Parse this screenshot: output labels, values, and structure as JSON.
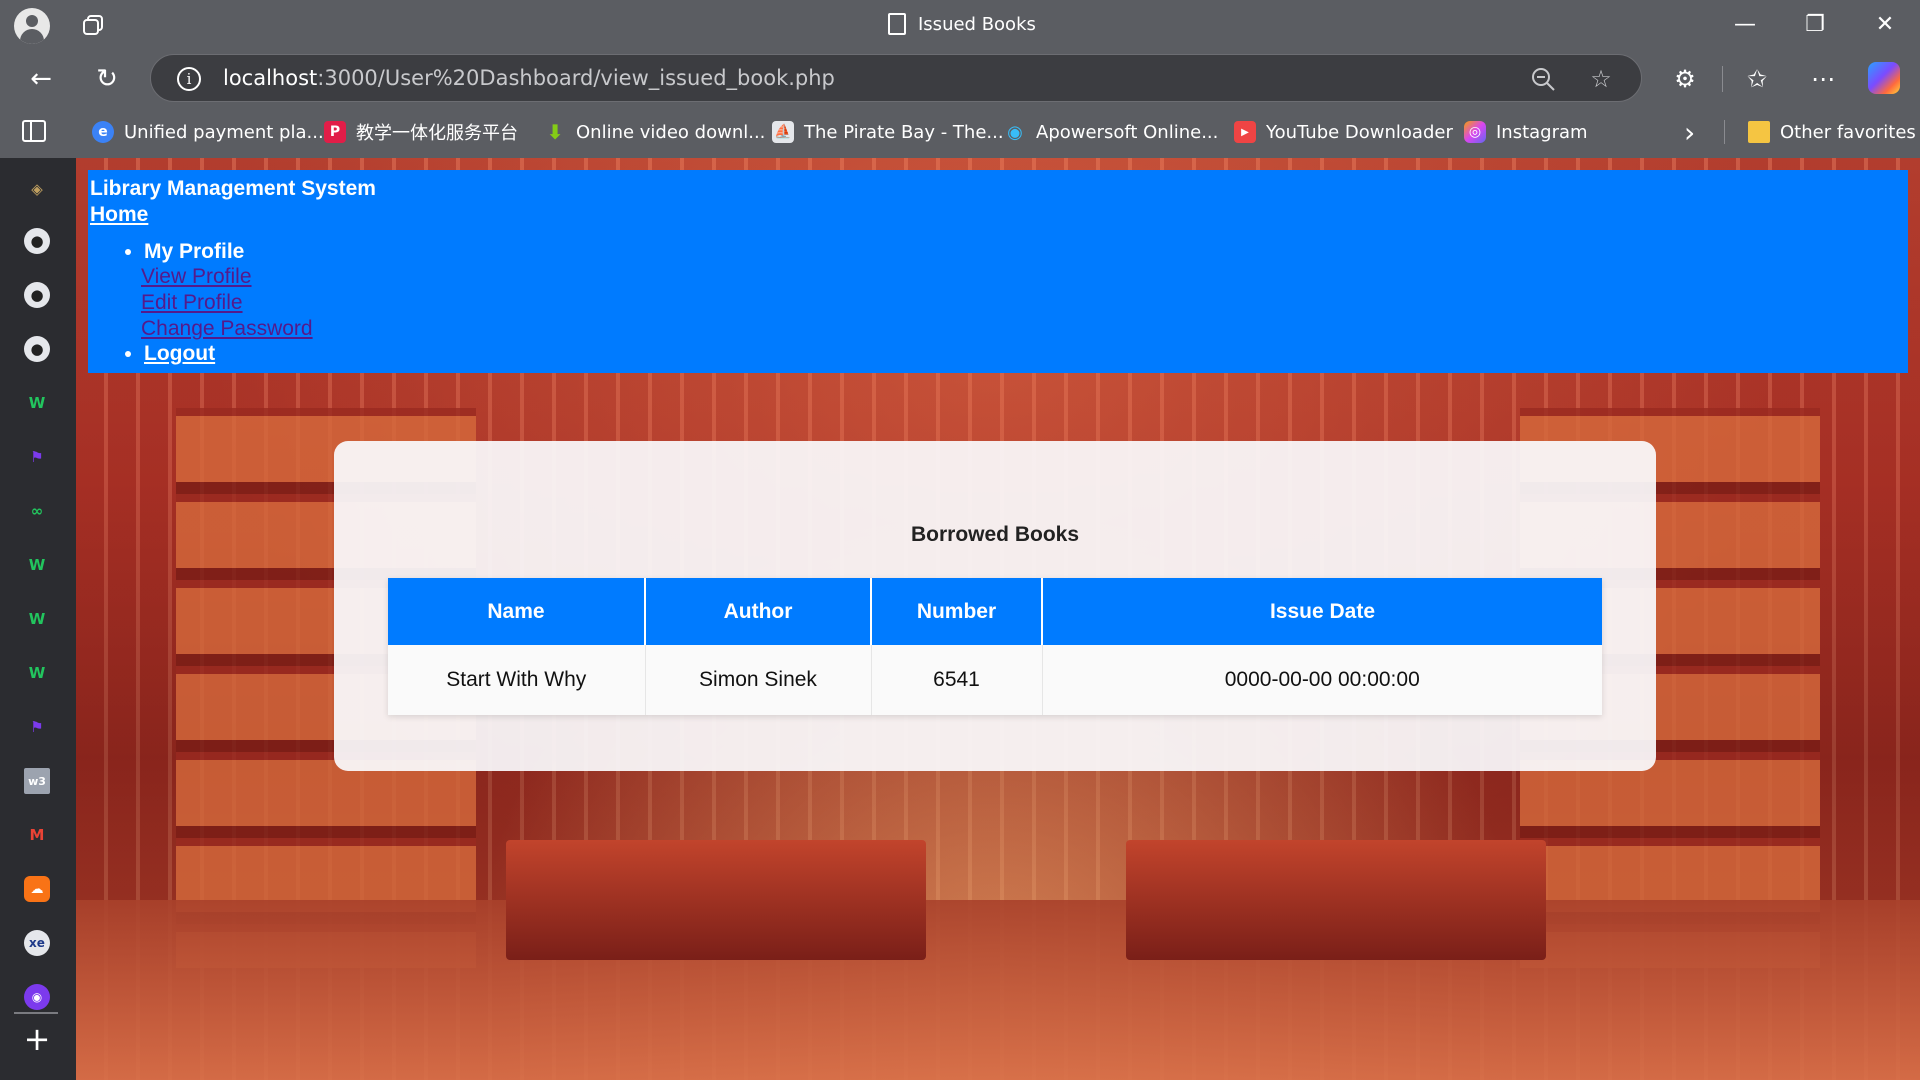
{
  "window": {
    "tab_title": "Issued Books",
    "minimize_glyph": "—",
    "restore_glyph": "❐",
    "close_glyph": "✕"
  },
  "address_bar": {
    "url_host": "localhost",
    "url_path": ":3000/User%20Dashboard/view_issued_book.php"
  },
  "bookmarks": [
    {
      "label": "Unified payment pla...",
      "icon": "payment-icon",
      "color": "#3b82f6",
      "glyph": "e"
    },
    {
      "label": "教学一体化服务平台",
      "icon": "p-logo-icon",
      "color": "#e11d48",
      "glyph": "P"
    },
    {
      "label": "Online video downl...",
      "icon": "download-arrow-icon",
      "color": "#84cc16",
      "glyph": "⬇"
    },
    {
      "label": "The Pirate Bay - The...",
      "icon": "pirate-ship-icon",
      "color": "#1f2937",
      "glyph": "⛵"
    },
    {
      "label": "Apowersoft Online...",
      "icon": "camera-icon",
      "color": "#0ea5e9",
      "glyph": "◉"
    },
    {
      "label": "YouTube Downloader",
      "icon": "youtube-icon",
      "color": "#ef4444",
      "glyph": "▶"
    },
    {
      "label": "Instagram",
      "icon": "instagram-icon",
      "color": "#d946ef",
      "glyph": "◎"
    }
  ],
  "bookmarks_overflow_glyph": "›",
  "other_favorites": "Other favorites",
  "page": {
    "brand": "Library Management System",
    "home": "Home",
    "menu": {
      "profile_heading": "My Profile",
      "view_profile": "View Profile",
      "edit_profile": "Edit Profile",
      "change_password": "Change Password",
      "logout": "Logout"
    },
    "card_title": "Borrowed Books",
    "table": {
      "headers": [
        "Name",
        "Author",
        "Number",
        "Issue Date"
      ],
      "rows": [
        [
          "Start With Why",
          "Simon Sinek",
          "6541",
          "0000-00-00 00:00:00"
        ]
      ]
    }
  },
  "colors": {
    "accent_blue": "#007bff",
    "browser_chrome": "#5b5d62"
  }
}
